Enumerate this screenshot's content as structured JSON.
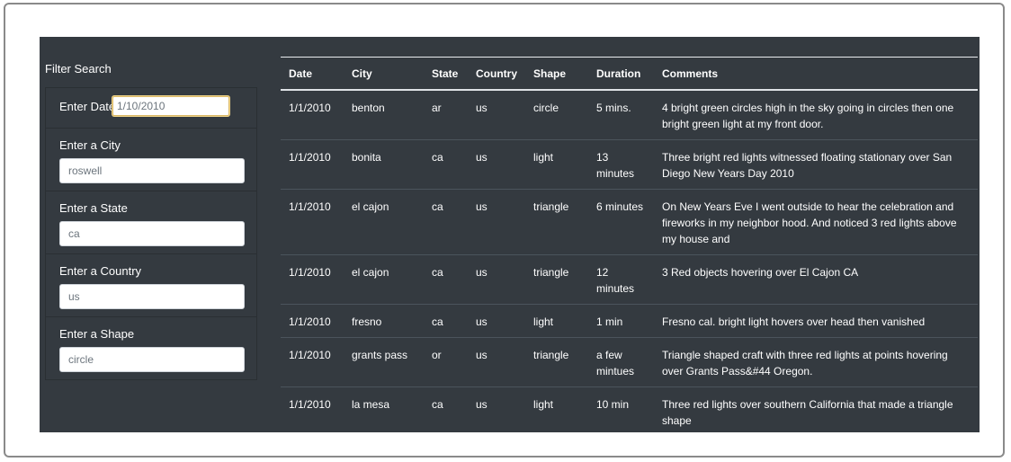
{
  "filter": {
    "title": "Filter Search",
    "date": {
      "label": "Enter Date",
      "placeholder": "1/10/2010"
    },
    "city": {
      "label": "Enter a City",
      "placeholder": "roswell"
    },
    "state": {
      "label": "Enter a State",
      "placeholder": "ca"
    },
    "country": {
      "label": "Enter a Country",
      "placeholder": "us"
    },
    "shape": {
      "label": "Enter a Shape",
      "placeholder": "circle"
    }
  },
  "table": {
    "headers": [
      "Date",
      "City",
      "State",
      "Country",
      "Shape",
      "Duration",
      "Comments"
    ],
    "rows": [
      [
        "1/1/2010",
        "benton",
        "ar",
        "us",
        "circle",
        "5 mins.",
        "4 bright green circles high in the sky going in circles then one bright green light at my front door."
      ],
      [
        "1/1/2010",
        "bonita",
        "ca",
        "us",
        "light",
        "13 minutes",
        "Three bright red lights witnessed floating stationary over San Diego New Years Day 2010"
      ],
      [
        "1/1/2010",
        "el cajon",
        "ca",
        "us",
        "triangle",
        "6 minutes",
        "On New Years Eve I went outside to hear the celebration and fireworks in my neighbor hood. And noticed 3 red lights above my house and"
      ],
      [
        "1/1/2010",
        "el cajon",
        "ca",
        "us",
        "triangle",
        "12 minutes",
        "3 Red objects hovering over El Cajon CA"
      ],
      [
        "1/1/2010",
        "fresno",
        "ca",
        "us",
        "light",
        "1 min",
        "Fresno cal. bright light hovers over head then vanished"
      ],
      [
        "1/1/2010",
        "grants pass",
        "or",
        "us",
        "triangle",
        "a few mintues",
        "Triangle shaped craft with three red lights at points hovering over Grants Pass&#44 Oregon."
      ],
      [
        "1/1/2010",
        "la mesa",
        "ca",
        "us",
        "light",
        "10 min",
        "Three red lights over southern California that made a triangle shape"
      ]
    ]
  }
}
